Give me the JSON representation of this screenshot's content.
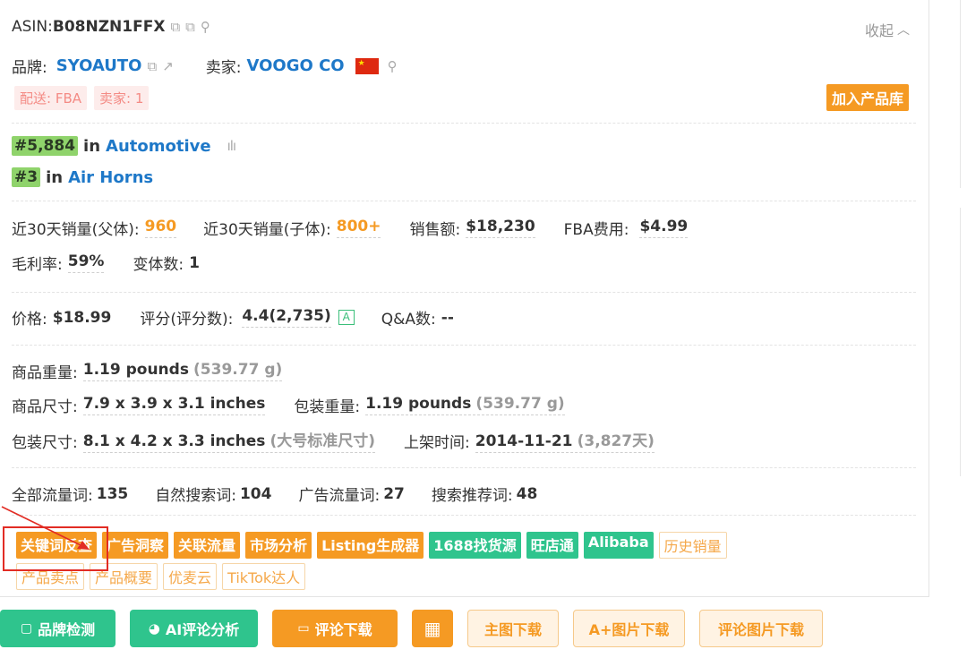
{
  "asin": {
    "label": "ASIN: ",
    "value": "B08NZN1FFX"
  },
  "collapse_label": "收起",
  "brand": {
    "label": "品牌:",
    "value": "SYOAUTO"
  },
  "seller": {
    "label": "卖家:",
    "value": "VOOGO CO"
  },
  "tags": {
    "delivery": "配送: FBA",
    "sellers": "卖家: 1"
  },
  "add_button": "加入产品库",
  "ranks": [
    {
      "rank": "#5,884",
      "in": "in",
      "category": "Automotive"
    },
    {
      "rank": "#3",
      "in": "in",
      "category": "Air Horns"
    }
  ],
  "sales": {
    "parent_label": "近30天销量(父体):",
    "parent_value": "960",
    "child_label": "近30天销量(子体):",
    "child_value": "800+",
    "revenue_label": "销售额:",
    "revenue_value": "$18,230",
    "fba_label": "FBA费用:",
    "fba_value": "$4.99",
    "margin_label": "毛利率:",
    "margin_value": "59%",
    "variants_label": "变体数:",
    "variants_value": "1"
  },
  "price": {
    "price_label": "价格:",
    "price_value": "$18.99",
    "rating_label": "评分(评分数):",
    "rating_value": "4.4(2,735)",
    "rating_badge": "A",
    "qa_label": "Q&A数:",
    "qa_value": "--"
  },
  "specs": {
    "weight_label": "商品重量:",
    "weight_value": "1.19 pounds",
    "weight_alt": "(539.77 g)",
    "dim_label": "商品尺寸:",
    "dim_value": "7.9 x 3.9 x 3.1 inches",
    "pkg_weight_label": "包装重量:",
    "pkg_weight_value": "1.19 pounds",
    "pkg_weight_alt": "(539.77 g)",
    "pkg_dim_label": "包装尺寸:",
    "pkg_dim_value": "8.1 x 4.2 x 3.3 inches",
    "pkg_dim_alt": "(大号标准尺寸)",
    "listed_label": "上架时间:",
    "listed_value": "2014-11-21",
    "listed_alt": "(3,827天)"
  },
  "traffic": {
    "all_label": "全部流量词:",
    "all_value": "135",
    "organic_label": "自然搜索词:",
    "organic_value": "104",
    "ad_label": "广告流量词:",
    "ad_value": "27",
    "rec_label": "搜索推荐词:",
    "rec_value": "48"
  },
  "tool_tags_row1": [
    "关键词反查",
    "广告洞察",
    "关联流量",
    "市场分析",
    "Listing生成器",
    "1688找货源",
    "旺店通",
    "Alibaba",
    "历史销量"
  ],
  "tool_tags_row2": [
    "产品卖点",
    "产品概要",
    "优麦云",
    "TikTok达人"
  ],
  "bottom_buttons": {
    "brand_check": "品牌检测",
    "ai_review": "AI评论分析",
    "review_download": "评论下载",
    "main_img": "主图下载",
    "aplus_img": "A+图片下载",
    "review_img": "评论图片下载"
  },
  "colors": {
    "accent_orange": "#f59a23",
    "accent_green": "#2fc48d",
    "link_blue": "#1e78c8",
    "highlight_red": "#e22c24"
  }
}
